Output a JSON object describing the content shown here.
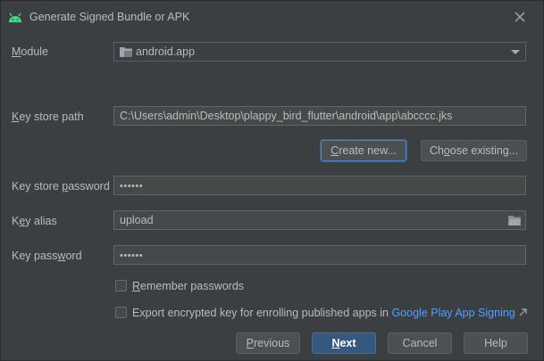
{
  "window": {
    "title": "Generate Signed Bundle or APK"
  },
  "module": {
    "label_pre": "",
    "label_u": "M",
    "label_post": "odule",
    "value": "android.app"
  },
  "keystore_path": {
    "label_u": "K",
    "label_post": "ey store path",
    "value": "C:\\Users\\admin\\Desktop\\plappy_bird_flutter\\android\\app\\abcccc.jks"
  },
  "buttons": {
    "create_new_u": "C",
    "create_new_post": "reate new...",
    "choose_existing_pre": "Ch",
    "choose_existing_u": "o",
    "choose_existing_post": "ose existing...",
    "previous_u": "P",
    "previous_post": "revious",
    "next_u": "N",
    "next_post": "ext",
    "cancel": "Cancel",
    "help": "Help"
  },
  "keystore_password": {
    "label_pre": "Key store ",
    "label_u": "p",
    "label_post": "assword",
    "value": "••••••"
  },
  "key_alias": {
    "label_pre": "K",
    "label_u": "e",
    "label_post": "y alias",
    "value": "upload"
  },
  "key_password": {
    "label_pre": "Key pass",
    "label_u": "w",
    "label_post": "ord",
    "value": "••••••"
  },
  "remember": {
    "label_u": "R",
    "label_post": "emember passwords",
    "checked": false
  },
  "export": {
    "label": "Export encrypted key for enrolling published apps in ",
    "link": "Google Play App Signing",
    "checked": false
  },
  "colors": {
    "accent": "#365880",
    "link": "#589df6",
    "android": "#3ddc84"
  },
  "icons": [
    "android-icon",
    "close-icon",
    "folder-icon",
    "chevron-down-icon",
    "browse-folder-icon",
    "external-link-icon"
  ]
}
